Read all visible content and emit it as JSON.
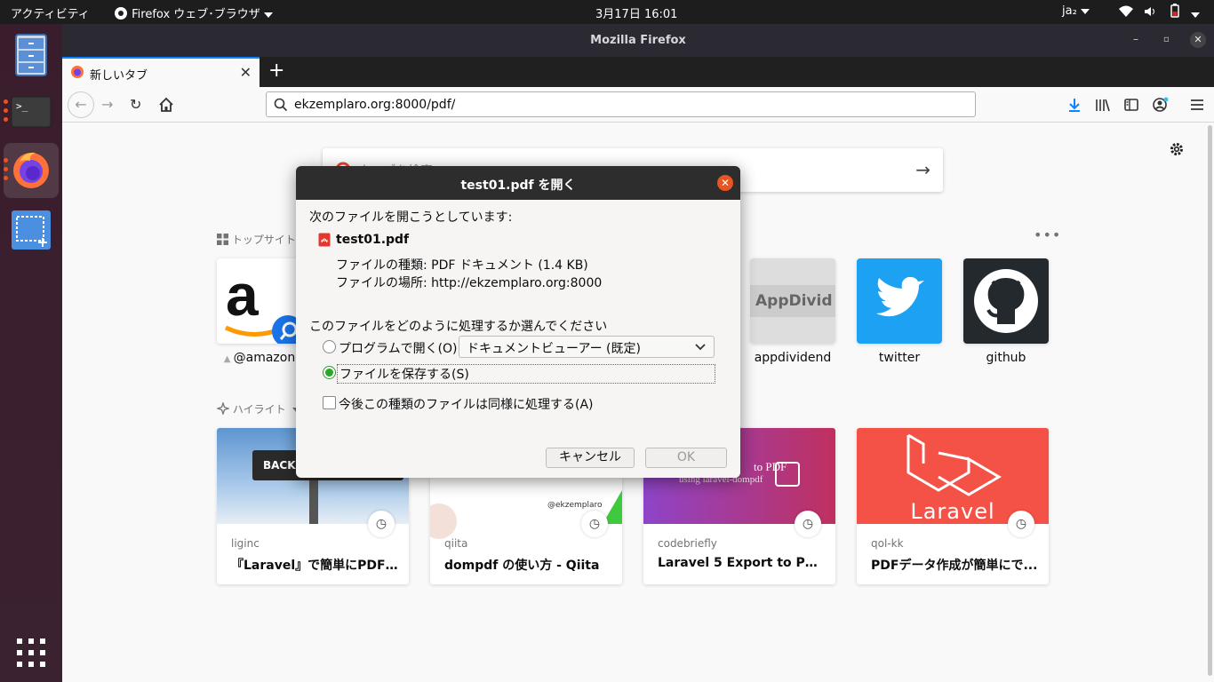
{
  "topbar": {
    "activities": "アクティビティ",
    "app_menu": "Firefox ウェブ･ブラウザ",
    "clock": "3月17日  16:01",
    "input_method": "ja₂"
  },
  "window": {
    "title": "Mozilla Firefox"
  },
  "tab": {
    "label": "新しいタブ"
  },
  "urlbar": {
    "url": "ekzemplaro.org:8000/pdf/"
  },
  "newtab": {
    "search_placeholder": "ウェブを検索",
    "top_sites_label": "トップサイト",
    "highlights_label": "ハイライト",
    "top_sites": [
      {
        "name": "@amazon"
      },
      {
        "name": "appdividend"
      },
      {
        "name": "twitter"
      },
      {
        "name": "github"
      }
    ],
    "highlights": [
      {
        "source": "liginc",
        "title": "『Laravel』で簡単にPDFデ..."
      },
      {
        "source": "qiita",
        "title": "dompdf の使い方 - Qiita"
      },
      {
        "source": "codebriefly",
        "title": "Laravel 5 Export to PDF u..."
      },
      {
        "source": "qol-kk",
        "title": "PDFデータ作成が簡単にで..."
      }
    ],
    "card_texts": {
      "backend": "BACKEN",
      "ekzemplaro": "@ekzemplaro",
      "to_pdf": "to PDF",
      "using_dompdf": "using laravel-dompdf",
      "laravel": "Laravel"
    }
  },
  "dialog": {
    "title": "test01.pdf を開く",
    "intro": "次のファイルを開こうとしています:",
    "filename": "test01.pdf",
    "file_type": "ファイルの種類: PDF ドキュメント (1.4 KB)",
    "file_location": "ファイルの場所: http://ekzemplaro.org:8000",
    "question": "このファイルをどのように処理するか選んでください",
    "open_with_label": "プログラムで開く(O):",
    "open_with_value": "ドキュメントビューアー (既定)",
    "save_label": "ファイルを保存する(S)",
    "remember_label": "今後この種類のファイルは同様に処理する(A)",
    "cancel": "キャンセル",
    "ok": "OK"
  },
  "colors": {
    "accent": "#e95420",
    "tab_highlight": "#0a84ff",
    "twitter": "#1da1f2",
    "github": "#24292e",
    "laravel": "#f55247"
  }
}
